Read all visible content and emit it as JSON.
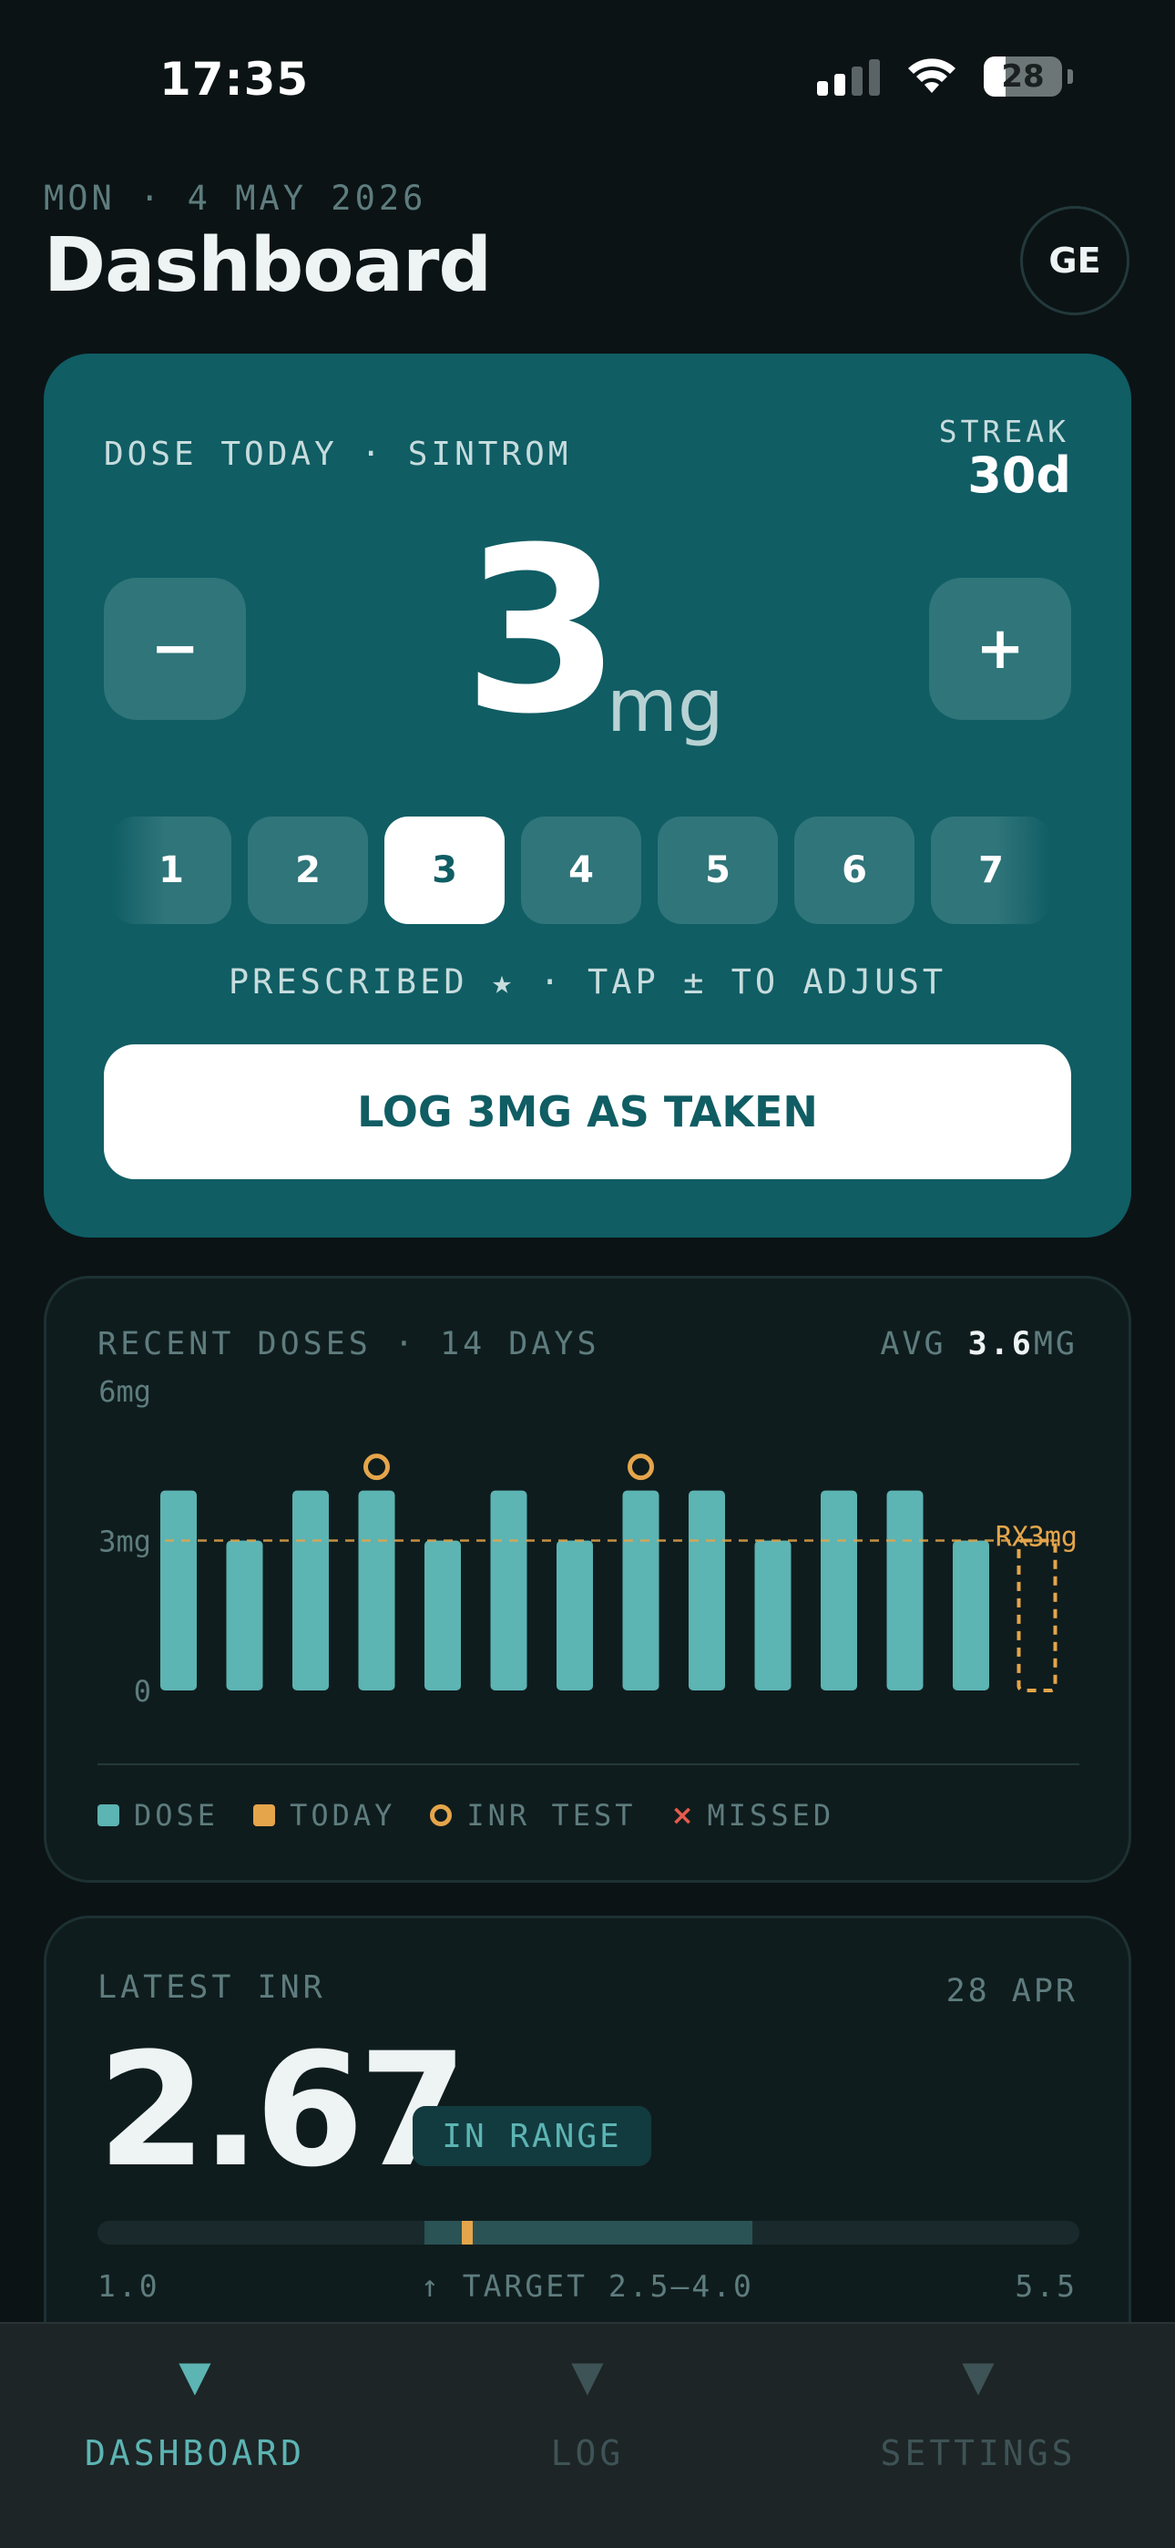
{
  "status_bar": {
    "time": "17:35",
    "battery": "28"
  },
  "header": {
    "date": "MON · 4 MAY 2026",
    "title": "Dashboard",
    "avatar": "GE"
  },
  "dose_card": {
    "title": "DOSE TODAY · SINTROM",
    "streak_label": "STREAK",
    "streak_value": "30d",
    "dose_value": "3",
    "dose_unit": "mg",
    "minus_label": "−",
    "plus_label": "+",
    "options": [
      "1",
      "2",
      "3",
      "4",
      "5",
      "6",
      "7"
    ],
    "selected_option": "3",
    "hint": "PRESCRIBED ★ · TAP ± TO ADJUST",
    "log_button": "LOG 3MG AS TAKEN"
  },
  "recent_doses": {
    "label": "RECENT DOSES · 14 DAYS",
    "avg_label": "AVG",
    "avg_value": "3.6",
    "avg_unit": "MG",
    "legend": {
      "dose": "DOSE",
      "today": "TODAY",
      "inr": "INR TEST",
      "missed": "MISSED"
    }
  },
  "chart_data": {
    "type": "bar",
    "title": "RECENT DOSES · 14 DAYS",
    "y_tick_labels": [
      "0",
      "3mg",
      "6mg"
    ],
    "ylim": [
      0,
      6
    ],
    "values": [
      4,
      3,
      4,
      4,
      3,
      4,
      3,
      4,
      4,
      3,
      4,
      4,
      3,
      null
    ],
    "today_index": 13,
    "today_value": 3,
    "inr_test_indices": [
      3,
      7
    ],
    "reference_line": {
      "value": 3,
      "label": "RX3mg"
    },
    "colors": {
      "dose": "#5cb4b3",
      "today": "#e5a54b",
      "inr": "#e5a54b",
      "missed": "#e45c4b"
    }
  },
  "latest_inr": {
    "label": "LATEST INR",
    "date": "28 APR",
    "value": "2.67",
    "status": "IN RANGE",
    "scale_min": "1.0",
    "scale_max": "5.5",
    "target_label": "↑ TARGET 2.5–4.0",
    "range_min": 1.0,
    "range_max": 5.5,
    "target_low": 2.5,
    "target_high": 4.0,
    "marker_value": 2.67
  },
  "tabs": [
    {
      "label": "DASHBOARD",
      "icon": "triangle-down-icon",
      "active": true
    },
    {
      "label": "LOG",
      "icon": "triangle-down-icon",
      "active": false
    },
    {
      "label": "SETTINGS",
      "icon": "triangle-down-icon",
      "active": false
    }
  ]
}
